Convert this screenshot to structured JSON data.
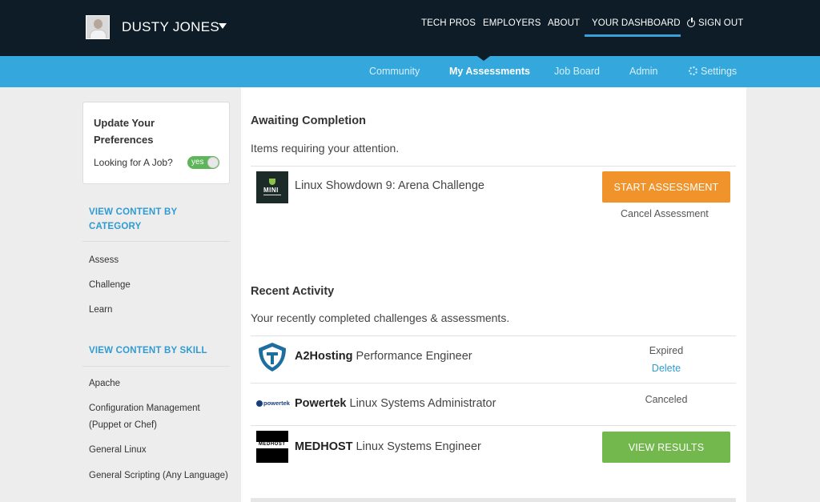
{
  "user": {
    "name": "DUSTY JONES"
  },
  "topnav": {
    "tech_pros": "TECH PROS",
    "employers": "EMPLOYERS",
    "about": "ABOUT",
    "dashboard": "YOUR DASHBOARD",
    "sign_out": "SIGN OUT"
  },
  "subnav": {
    "community": "Community",
    "assessments": "My Assessments",
    "job_board": "Job Board",
    "admin": "Admin",
    "settings": "Settings"
  },
  "preferences": {
    "title": "Update Your Preferences",
    "label": "Looking for A Job?",
    "toggle_value": "yes"
  },
  "sidebar": {
    "category_heading": "VIEW CONTENT BY CATEGORY",
    "categories": [
      "Assess",
      "Challenge",
      "Learn"
    ],
    "skill_heading": "VIEW CONTENT BY SKILL",
    "skills": [
      "Apache",
      "Configuration Management (Puppet or Chef)",
      "General Linux",
      "General Scripting (Any Language)"
    ]
  },
  "awaiting": {
    "title": "Awaiting Completion",
    "subtitle": "Items requiring your attention.",
    "items": [
      {
        "logo_text": "MINI",
        "title": "Linux Showdown 9: Arena Challenge",
        "action": "START ASSESSMENT",
        "secondary": "Cancel Assessment"
      }
    ]
  },
  "recent": {
    "title": "Recent Activity",
    "subtitle": "Your recently completed challenges & assessments.",
    "items": [
      {
        "company": "A2Hosting",
        "role": "Performance Engineer",
        "status": "Expired",
        "link": "Delete"
      },
      {
        "company": "Powertek",
        "role": "Linux Systems Administrator",
        "status": "Canceled",
        "logo_text": "powertek"
      },
      {
        "company": "MEDHOST",
        "role": "Linux Systems Engineer",
        "action": "VIEW RESULTS",
        "logo_text": "MEDHOST"
      }
    ]
  },
  "colors": {
    "topbar": "#0d1c26",
    "subbar": "#34a7dc",
    "accent_link": "#2f9bd2",
    "orange_button": "#f0932a",
    "green_button": "#72b84c"
  }
}
